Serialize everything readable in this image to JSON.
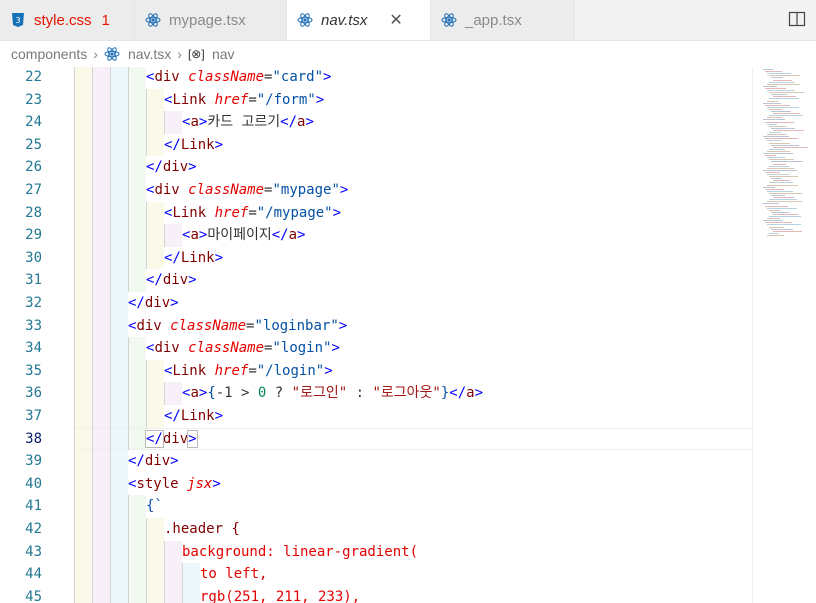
{
  "tabs": [
    {
      "label": "style.css",
      "badge": "1",
      "icon": "css-icon",
      "active": false,
      "error": true
    },
    {
      "label": "mypage.tsx",
      "icon": "react-icon",
      "active": false
    },
    {
      "label": "nav.tsx",
      "icon": "react-icon",
      "active": true,
      "close": "✕"
    },
    {
      "label": "_app.tsx",
      "icon": "react-icon",
      "active": false
    }
  ],
  "breadcrumb": {
    "folder": "components",
    "file": "nav.tsx",
    "symbol": "nav"
  },
  "colors": {
    "line_number": "#237893",
    "tag": "#800000",
    "attribute": "#e50000",
    "string": "#0451a5",
    "keyword": "#0000ff"
  },
  "current_line": 38,
  "lines": [
    {
      "n": "22",
      "indent": 4,
      "html": [
        [
          "br",
          "<"
        ],
        [
          "tag",
          "div"
        ],
        [
          "op",
          " "
        ],
        [
          "attr",
          "className"
        ],
        [
          "op",
          "="
        ],
        [
          "val",
          "\"card\""
        ],
        [
          "br",
          ">"
        ]
      ]
    },
    {
      "n": "23",
      "indent": 5,
      "html": [
        [
          "br",
          "<"
        ],
        [
          "tag",
          "Link"
        ],
        [
          "op",
          " "
        ],
        [
          "attr",
          "href"
        ],
        [
          "op",
          "="
        ],
        [
          "val",
          "\"/form\""
        ],
        [
          "br",
          ">"
        ]
      ]
    },
    {
      "n": "24",
      "indent": 6,
      "html": [
        [
          "br",
          "<"
        ],
        [
          "tag",
          "a"
        ],
        [
          "br",
          ">"
        ],
        [
          "op",
          "카드 고르기"
        ],
        [
          "br",
          "</"
        ],
        [
          "tag",
          "a"
        ],
        [
          "br",
          ">"
        ]
      ]
    },
    {
      "n": "25",
      "indent": 5,
      "html": [
        [
          "br",
          "</"
        ],
        [
          "tag",
          "Link"
        ],
        [
          "br",
          ">"
        ]
      ]
    },
    {
      "n": "26",
      "indent": 4,
      "html": [
        [
          "br",
          "</"
        ],
        [
          "tag",
          "div"
        ],
        [
          "br",
          ">"
        ]
      ]
    },
    {
      "n": "27",
      "indent": 4,
      "html": [
        [
          "br",
          "<"
        ],
        [
          "tag",
          "div"
        ],
        [
          "op",
          " "
        ],
        [
          "attr",
          "className"
        ],
        [
          "op",
          "="
        ],
        [
          "val",
          "\"mypage\""
        ],
        [
          "br",
          ">"
        ]
      ]
    },
    {
      "n": "28",
      "indent": 5,
      "html": [
        [
          "br",
          "<"
        ],
        [
          "tag",
          "Link"
        ],
        [
          "op",
          " "
        ],
        [
          "attr",
          "href"
        ],
        [
          "op",
          "="
        ],
        [
          "val",
          "\"/mypage\""
        ],
        [
          "br",
          ">"
        ]
      ]
    },
    {
      "n": "29",
      "indent": 6,
      "html": [
        [
          "br",
          "<"
        ],
        [
          "tag",
          "a"
        ],
        [
          "br",
          ">"
        ],
        [
          "op",
          "마이페이지"
        ],
        [
          "br",
          "</"
        ],
        [
          "tag",
          "a"
        ],
        [
          "br",
          ">"
        ]
      ]
    },
    {
      "n": "30",
      "indent": 5,
      "html": [
        [
          "br",
          "</"
        ],
        [
          "tag",
          "Link"
        ],
        [
          "br",
          ">"
        ]
      ]
    },
    {
      "n": "31",
      "indent": 4,
      "html": [
        [
          "br",
          "</"
        ],
        [
          "tag",
          "div"
        ],
        [
          "br",
          ">"
        ]
      ]
    },
    {
      "n": "32",
      "indent": 3,
      "html": [
        [
          "br",
          "</"
        ],
        [
          "tag",
          "div"
        ],
        [
          "br",
          ">"
        ]
      ]
    },
    {
      "n": "33",
      "indent": 3,
      "html": [
        [
          "br",
          "<"
        ],
        [
          "tag",
          "div"
        ],
        [
          "op",
          " "
        ],
        [
          "attr",
          "className"
        ],
        [
          "op",
          "="
        ],
        [
          "val",
          "\"loginbar\""
        ],
        [
          "br",
          ">"
        ]
      ]
    },
    {
      "n": "34",
      "indent": 4,
      "html": [
        [
          "br",
          "<"
        ],
        [
          "tag",
          "div"
        ],
        [
          "op",
          " "
        ],
        [
          "attr",
          "className"
        ],
        [
          "op",
          "="
        ],
        [
          "val",
          "\"login\""
        ],
        [
          "br",
          ">"
        ]
      ]
    },
    {
      "n": "35",
      "indent": 5,
      "html": [
        [
          "br",
          "<"
        ],
        [
          "tag",
          "Link"
        ],
        [
          "op",
          " "
        ],
        [
          "attr",
          "href"
        ],
        [
          "op",
          "="
        ],
        [
          "val",
          "\"/login\""
        ],
        [
          "br",
          ">"
        ]
      ]
    },
    {
      "n": "36",
      "indent": 6,
      "html": [
        [
          "br",
          "<"
        ],
        [
          "tag",
          "a"
        ],
        [
          "br",
          ">"
        ],
        [
          "val",
          "{"
        ],
        [
          "op",
          "-1 > "
        ],
        [
          "num",
          "0"
        ],
        [
          "op",
          " ? "
        ],
        [
          "str",
          "\"로그인\""
        ],
        [
          "op",
          " : "
        ],
        [
          "str",
          "\"로그아웃\""
        ],
        [
          "val",
          "}"
        ],
        [
          "br",
          "</"
        ],
        [
          "tag",
          "a"
        ],
        [
          "br",
          ">"
        ]
      ]
    },
    {
      "n": "37",
      "indent": 5,
      "html": [
        [
          "br",
          "</"
        ],
        [
          "tag",
          "Link"
        ],
        [
          "br",
          ">"
        ]
      ]
    },
    {
      "n": "38",
      "indent": 4,
      "html": [
        [
          "br",
          "</"
        ],
        [
          "tag",
          "div"
        ],
        [
          "br",
          ">"
        ]
      ]
    },
    {
      "n": "39",
      "indent": 3,
      "html": [
        [
          "br",
          "</"
        ],
        [
          "tag",
          "div"
        ],
        [
          "br",
          ">"
        ]
      ]
    },
    {
      "n": "40",
      "indent": 3,
      "html": [
        [
          "br",
          "<"
        ],
        [
          "tag",
          "style"
        ],
        [
          "op",
          " "
        ],
        [
          "attr",
          "jsx"
        ],
        [
          "br",
          ">"
        ]
      ]
    },
    {
      "n": "41",
      "indent": 4,
      "html": [
        [
          "val",
          "{`"
        ]
      ]
    },
    {
      "n": "42",
      "indent": 5,
      "html": [
        [
          "css-sel",
          ".header {"
        ]
      ]
    },
    {
      "n": "43",
      "indent": 6,
      "html": [
        [
          "css-prop",
          "background: linear-gradient("
        ]
      ]
    },
    {
      "n": "44",
      "indent": 7,
      "html": [
        [
          "css-prop",
          "to left,"
        ]
      ]
    },
    {
      "n": "45",
      "indent": 7,
      "html": [
        [
          "css-prop",
          "rgb(251, 211, 233),"
        ]
      ]
    }
  ]
}
